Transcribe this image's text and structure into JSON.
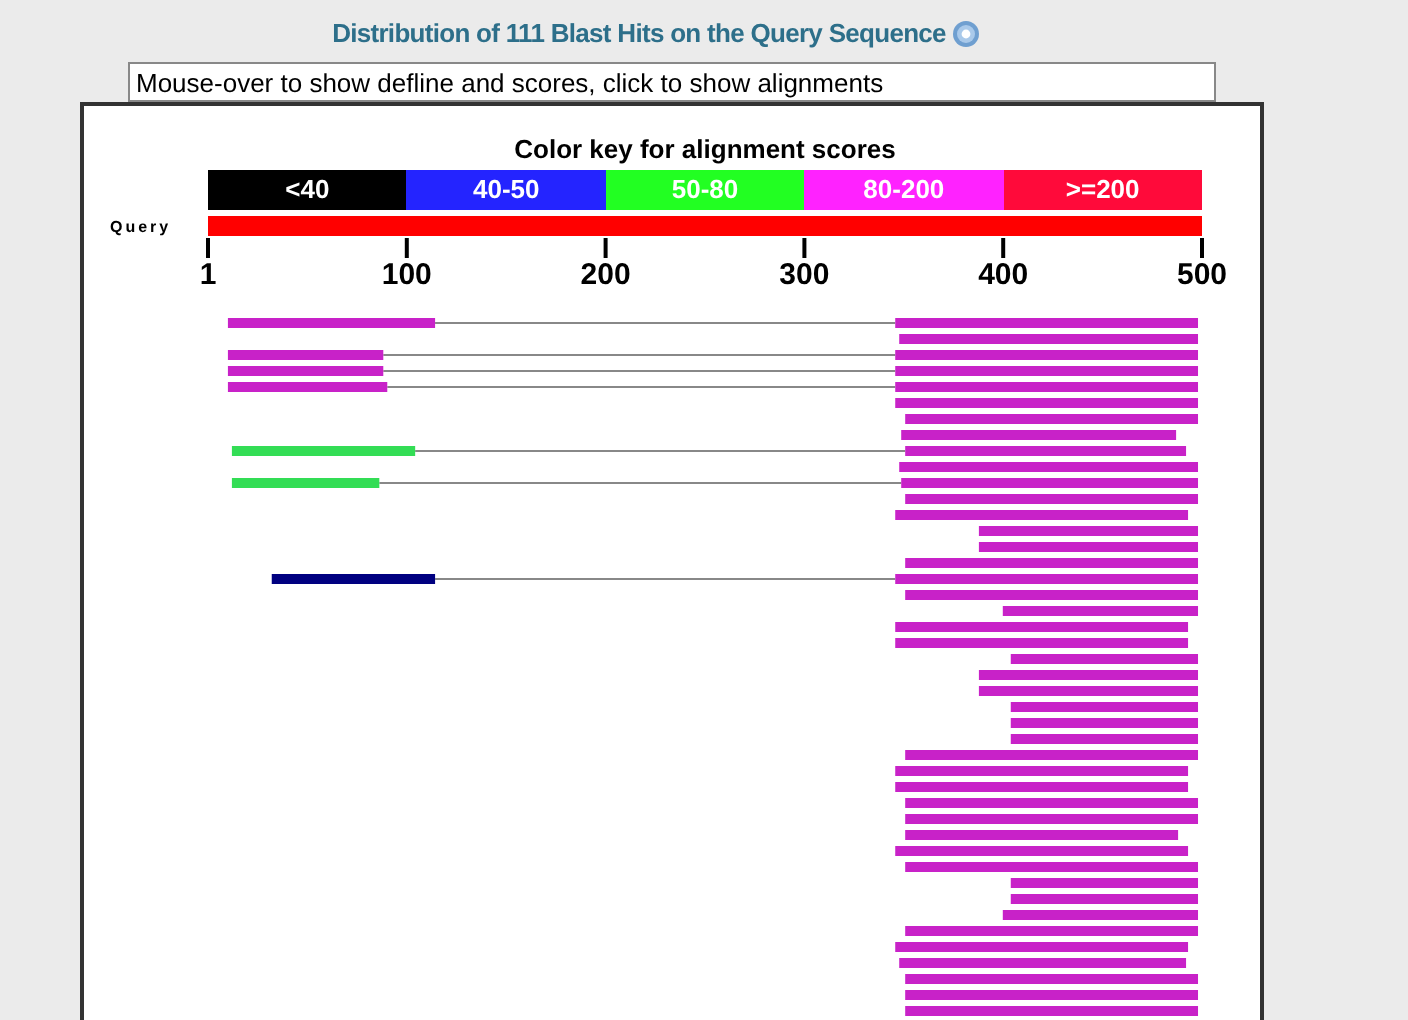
{
  "title": "Distribution of 111 Blast Hits on the Query Sequence",
  "hint_field": {
    "value": "Mouse-over to show defline and scores, click to show alignments"
  },
  "key": {
    "title": "Color key for alignment scores",
    "items": [
      {
        "label": "<40",
        "color": "#000000"
      },
      {
        "label": "40-50",
        "color": "#2424ff"
      },
      {
        "label": "50-80",
        "color": "#22ff22"
      },
      {
        "label": "80-200",
        "color": "#ff22ff"
      },
      {
        "label": ">=200",
        "color": "#ff0a3a"
      }
    ]
  },
  "query": {
    "label": "Query"
  },
  "axis": {
    "labels": [
      "1",
      "100",
      "200",
      "300",
      "400",
      "500"
    ]
  },
  "alignments": {
    "hits": [
      {
        "segments": [
          {
            "color": "#c822c8"
          },
          {
            "color": "#c822c8"
          }
        ]
      },
      {
        "segments": [
          {
            "color": "#c822c8"
          }
        ]
      },
      {
        "segments": [
          {
            "color": "#c822c8"
          },
          {
            "color": "#c822c8"
          }
        ]
      },
      {
        "segments": [
          {
            "color": "#c822c8"
          },
          {
            "color": "#c822c8"
          }
        ]
      },
      {
        "segments": [
          {
            "color": "#c822c8"
          },
          {
            "color": "#c822c8"
          }
        ]
      },
      {
        "segments": [
          {
            "color": "#c822c8"
          }
        ]
      },
      {
        "segments": [
          {
            "color": "#c822c8"
          }
        ]
      },
      {
        "segments": [
          {
            "color": "#c822c8"
          }
        ]
      },
      {
        "segments": [
          {
            "color": "#33dd55"
          },
          {
            "color": "#c822c8"
          }
        ]
      },
      {
        "segments": [
          {
            "color": "#c822c8"
          }
        ]
      },
      {
        "segments": [
          {
            "color": "#33dd55"
          },
          {
            "color": "#c822c8"
          }
        ]
      },
      {
        "segments": [
          {
            "color": "#c822c8"
          }
        ]
      },
      {
        "segments": [
          {
            "color": "#c822c8"
          }
        ]
      },
      {
        "segments": [
          {
            "color": "#c822c8"
          }
        ]
      },
      {
        "segments": [
          {
            "color": "#c822c8"
          }
        ]
      },
      {
        "segments": [
          {
            "color": "#c822c8"
          }
        ]
      },
      {
        "segments": [
          {
            "color": "#000080"
          },
          {
            "color": "#c822c8"
          }
        ]
      },
      {
        "segments": [
          {
            "color": "#c822c8"
          }
        ]
      },
      {
        "segments": [
          {
            "color": "#c822c8"
          }
        ]
      },
      {
        "segments": [
          {
            "color": "#c822c8"
          }
        ]
      },
      {
        "segments": [
          {
            "color": "#c822c8"
          }
        ]
      },
      {
        "segments": [
          {
            "color": "#c822c8"
          }
        ]
      },
      {
        "segments": [
          {
            "color": "#c822c8"
          }
        ]
      },
      {
        "segments": [
          {
            "color": "#c822c8"
          }
        ]
      },
      {
        "segments": [
          {
            "color": "#c822c8"
          }
        ]
      },
      {
        "segments": [
          {
            "color": "#c822c8"
          }
        ]
      },
      {
        "segments": [
          {
            "color": "#c822c8"
          }
        ]
      },
      {
        "segments": [
          {
            "color": "#c822c8"
          }
        ]
      },
      {
        "segments": [
          {
            "color": "#c822c8"
          }
        ]
      },
      {
        "segments": [
          {
            "color": "#c822c8"
          }
        ]
      },
      {
        "segments": [
          {
            "color": "#c822c8"
          }
        ]
      },
      {
        "segments": [
          {
            "color": "#c822c8"
          }
        ]
      },
      {
        "segments": [
          {
            "color": "#c822c8"
          }
        ]
      },
      {
        "segments": [
          {
            "color": "#c822c8"
          }
        ]
      },
      {
        "segments": [
          {
            "color": "#c822c8"
          }
        ]
      },
      {
        "segments": [
          {
            "color": "#c822c8"
          }
        ]
      },
      {
        "segments": [
          {
            "color": "#c822c8"
          }
        ]
      },
      {
        "segments": [
          {
            "color": "#c822c8"
          }
        ]
      },
      {
        "segments": [
          {
            "color": "#c822c8"
          }
        ]
      },
      {
        "segments": [
          {
            "color": "#c822c8"
          }
        ]
      },
      {
        "segments": [
          {
            "color": "#c822c8"
          }
        ]
      },
      {
        "segments": [
          {
            "color": "#c822c8"
          }
        ]
      },
      {
        "segments": [
          {
            "color": "#c822c8"
          }
        ]
      },
      {
        "segments": [
          {
            "color": "#c822c8"
          }
        ]
      }
    ]
  }
}
